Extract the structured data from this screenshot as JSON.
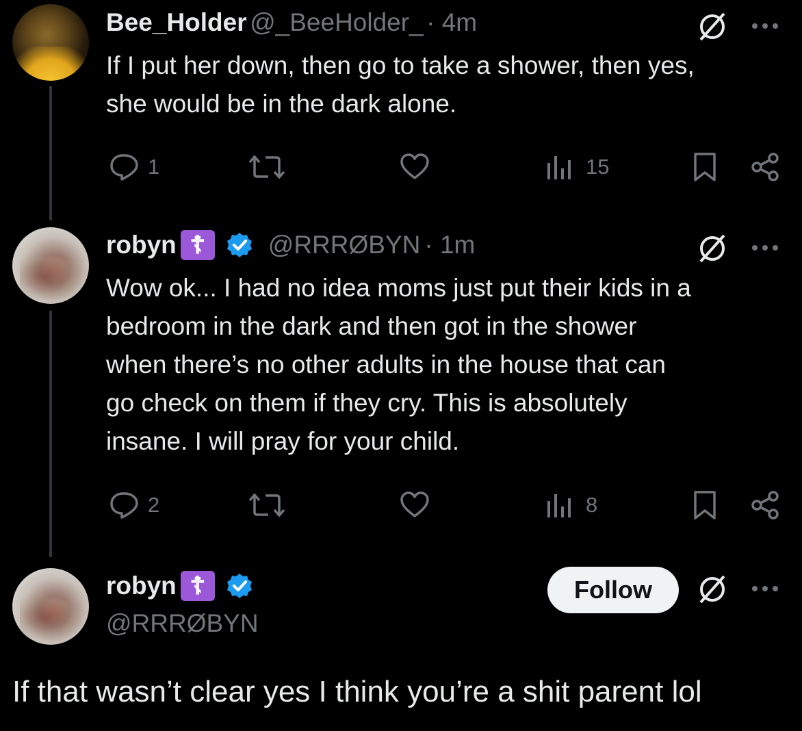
{
  "tweets": [
    {
      "name": "Bee_Holder",
      "handle": "@_BeeHolder_",
      "time": "· 4m",
      "text_lines": [
        "If I put her down, then go to take a shower, then yes,",
        "she would be in the dark alone."
      ],
      "replies": "1",
      "views": "15"
    },
    {
      "name": "robyn",
      "badge": "☦",
      "handle": "@RRRØBYN",
      "time": "· 1m",
      "text_lines": [
        "Wow ok... I had no idea moms just put their kids in a",
        "bedroom in the dark and then got in the shower",
        "when there’s no other adults in the house that can",
        "go check on them if they cry. This is absolutely",
        "insane. I will pray for your child."
      ],
      "replies": "2",
      "views": "8"
    }
  ],
  "main_tweet": {
    "name": "robyn",
    "badge": "☦",
    "handle": "@RRRØBYN",
    "follow_label": "Follow",
    "text": "If that wasn’t clear yes I think you’re a shit parent lol"
  },
  "colors": {
    "background": "#000000",
    "text": "#e7e9ea",
    "muted": "#71767b",
    "verified": "#1d9bf0",
    "badge": "#9b59d9"
  }
}
